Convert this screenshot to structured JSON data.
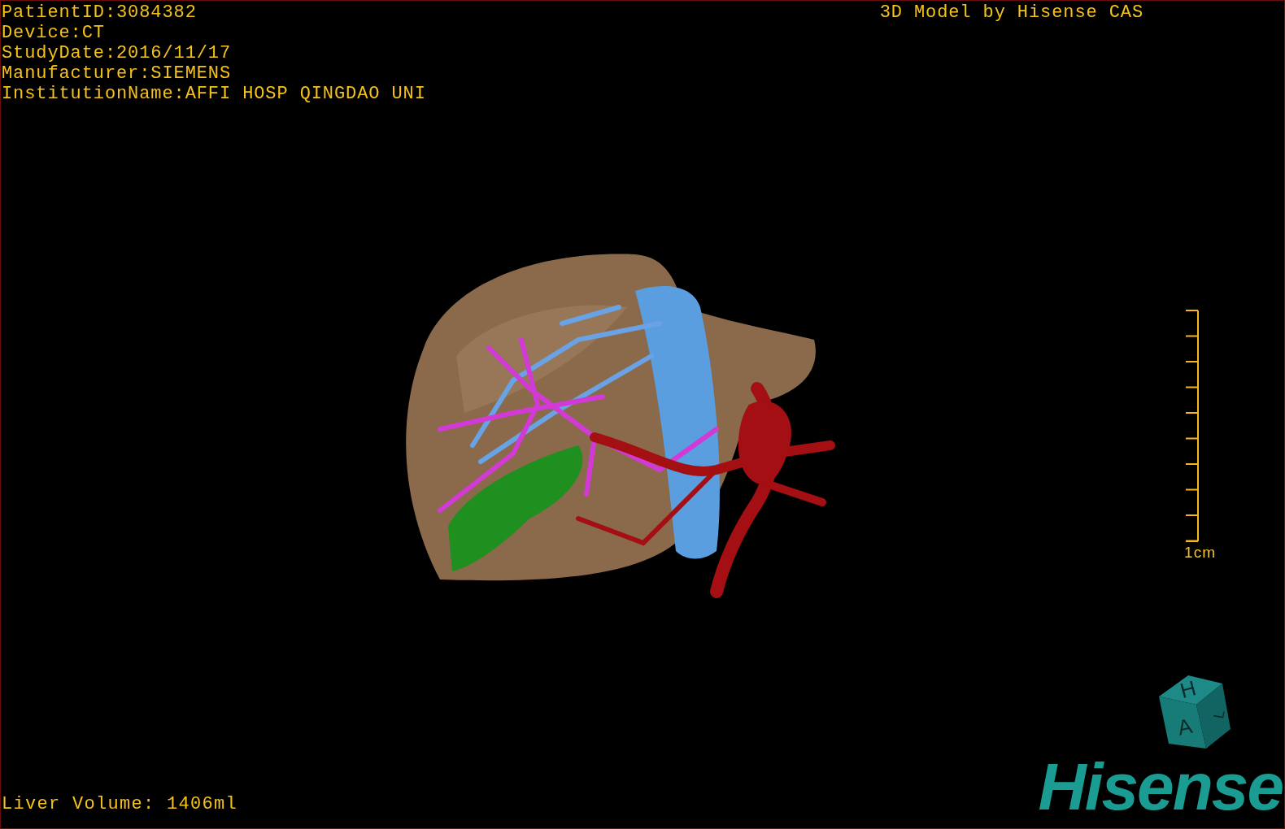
{
  "patient_info": [
    "PatientID:3084382",
    "Device:CT",
    "StudyDate:2016/11/17",
    "Manufacturer:SIEMENS",
    "InstitutionName:AFFI HOSP QINGDAO UNI"
  ],
  "title": "3D Model by Hisense CAS",
  "scale": {
    "label": "1cm"
  },
  "orientation_cube": {
    "faces": [
      "H",
      "A",
      "L"
    ]
  },
  "logo": "Hisense",
  "liver_volume": "Liver Volume: 1406ml"
}
